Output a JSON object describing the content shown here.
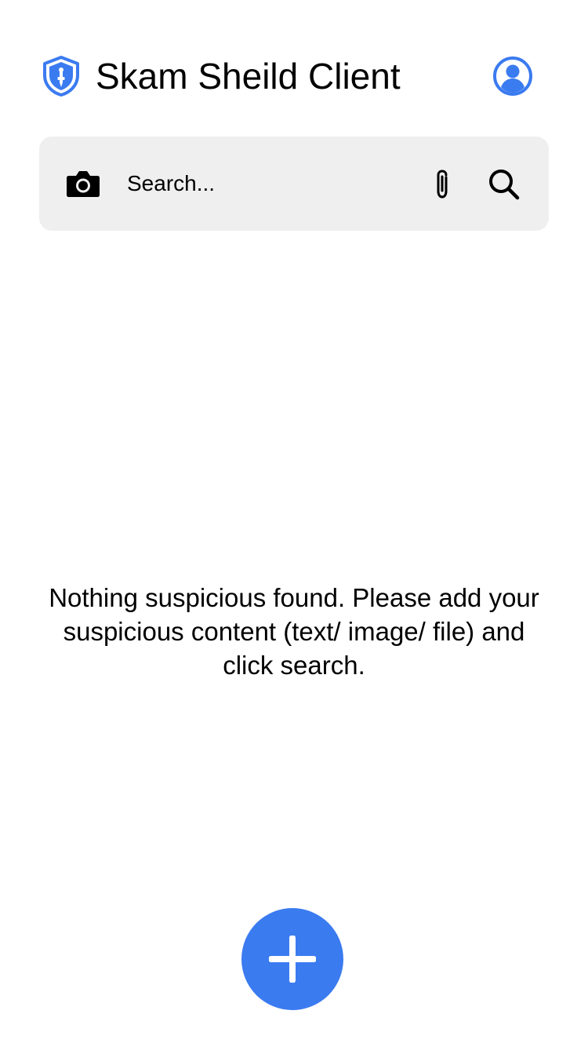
{
  "header": {
    "title": "Skam Sheild Client",
    "logo_icon": "shield-icon",
    "profile_icon": "user-circle-icon"
  },
  "search": {
    "placeholder": "Search...",
    "value": "",
    "camera_icon": "camera-icon",
    "attach_icon": "paperclip-icon",
    "search_icon": "search-icon"
  },
  "empty_state": {
    "message": "Nothing suspicious found. Please add your suspicious content (text/ image/ file) and click search."
  },
  "fab": {
    "icon": "plus-icon"
  },
  "colors": {
    "accent": "#3b7bf0",
    "search_bg": "#efefef",
    "text": "#000000"
  }
}
